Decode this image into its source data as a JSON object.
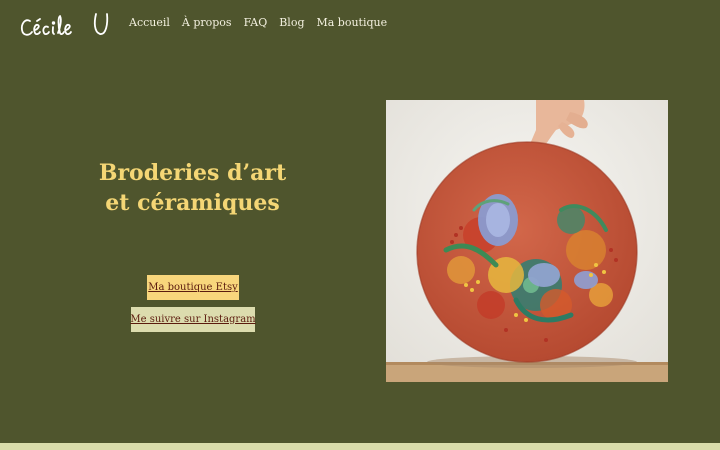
{
  "header": {
    "logo_text": "Cécile U",
    "nav": [
      {
        "label": "Accueil"
      },
      {
        "label": "À propos"
      },
      {
        "label": "FAQ"
      },
      {
        "label": "Blog"
      },
      {
        "label": "Ma boutique"
      }
    ]
  },
  "hero": {
    "title_line1": "Broderies d’art",
    "title_line2": "et céramiques",
    "button_etsy": "Ma boutique Etsy",
    "button_instagram": "Me suivre sur Instagram"
  },
  "colors": {
    "background": "#4f552d",
    "title": "#f4d675",
    "button_etsy_bg": "#f8d67c",
    "button_instagram_bg": "#dcdcae",
    "button_text": "#5b1b0e",
    "footer_strip": "#d9dcaa"
  },
  "image": {
    "subject": "embroidery-hoop-photo"
  }
}
